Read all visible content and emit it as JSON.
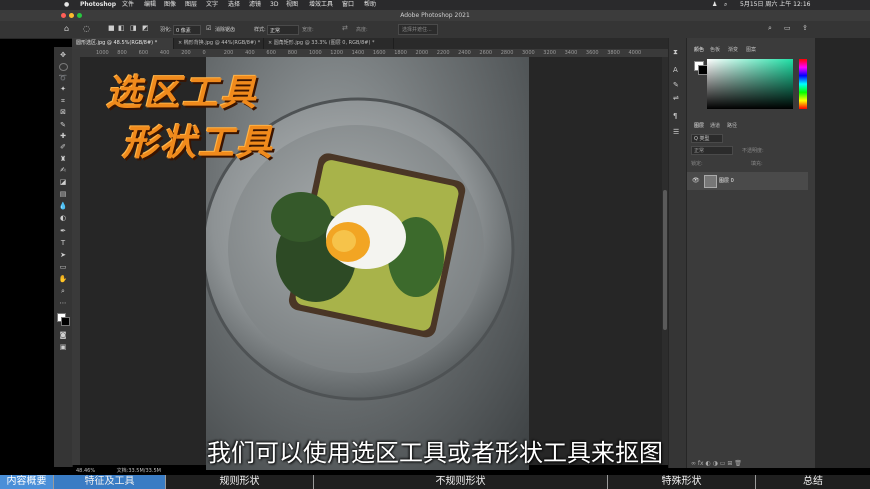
{
  "menubar": {
    "apple": "",
    "app": "Photoshop",
    "items": [
      "文件",
      "编辑",
      "图像",
      "图层",
      "文字",
      "选择",
      "滤镜",
      "3D",
      "视图",
      "增效工具",
      "窗口",
      "帮助"
    ],
    "datetime": "5月15日 周六 上午 12:16"
  },
  "window_title": "Adobe Photoshop 2021",
  "options": {
    "feather_label": "羽化:",
    "feather_value": "0 像素",
    "antialias_label": "消除锯齿",
    "style_label": "样式:",
    "style_value": "正常",
    "width_label": "宽度:",
    "height_label": "高度:",
    "select_mask": "选择并遮住..."
  },
  "tabs": [
    {
      "label": "圆形选区.jpg @ 48.5%(RGB/8#) *",
      "active": true
    },
    {
      "label": "× 椭形背换.jpg @ 44%(RGB/8#) *",
      "active": false
    },
    {
      "label": "× 圆角矩形.jpg @ 33.3% (图层 0, RGB/8#) *",
      "active": false
    }
  ],
  "ruler_ticks": [
    "1000",
    "800",
    "600",
    "400",
    "200",
    "0",
    "200",
    "400",
    "600",
    "800",
    "1000",
    "1200",
    "1400",
    "1600",
    "1800",
    "2000",
    "2200",
    "2400",
    "2600",
    "2800",
    "3000",
    "3200",
    "3400",
    "3600",
    "3800",
    "4000"
  ],
  "status": {
    "zoom": "48.46%",
    "doc": "文档:33.5M/33.5M"
  },
  "color_panel": {
    "tabs": [
      "颜色",
      "色板",
      "渐变",
      "图案"
    ],
    "accent": "#20e0a6"
  },
  "layers_panel": {
    "tabs": [
      "图层",
      "通道",
      "路径"
    ],
    "kind_label": "Q 类型",
    "blend_mode": "正常",
    "opacity_label": "不透明度:",
    "lock_label": "锁定:",
    "fill_label": "填充:",
    "layer_name": "图层 0"
  },
  "overlay_titles": {
    "line1": "选区工具",
    "line2": "形状工具"
  },
  "subtitle": "我们可以使用选区工具或者形状工具来抠图",
  "bottom_nav": [
    "内容概要",
    "特征及工具",
    "规则形状",
    "不规则形状",
    "特殊形状",
    "总结"
  ]
}
